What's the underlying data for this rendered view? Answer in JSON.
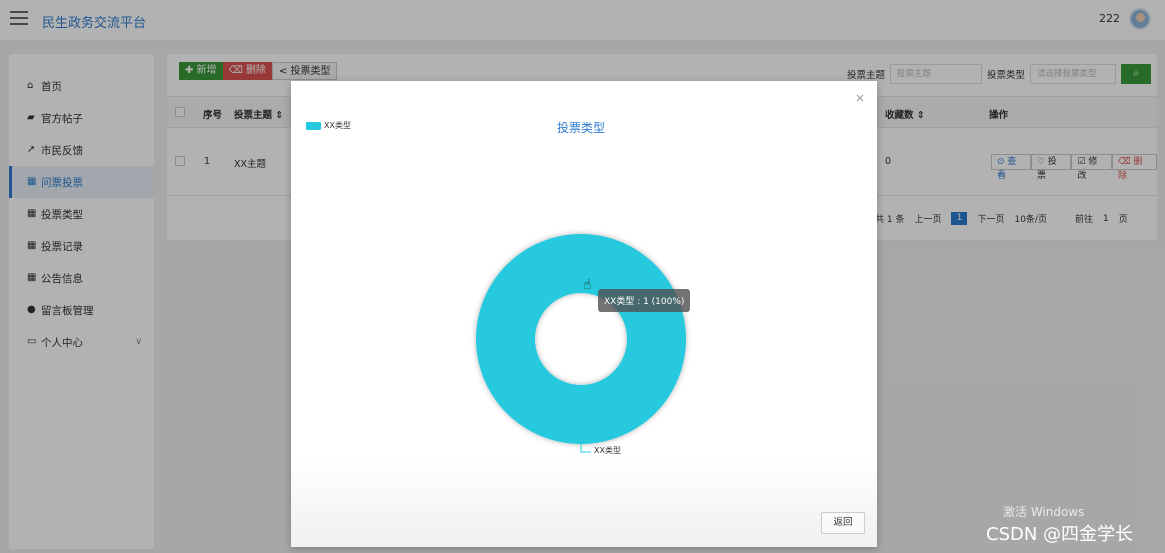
{
  "header": {
    "title": "民生政务交流平台",
    "username": "222"
  },
  "sidebar": {
    "items": [
      {
        "label": "首页",
        "icon": "home-icon",
        "glyph": "⌂"
      },
      {
        "label": "官方帖子",
        "icon": "post-icon",
        "glyph": "▰"
      },
      {
        "label": "市民反馈",
        "icon": "send-icon",
        "glyph": "➚"
      },
      {
        "label": "问票投票",
        "icon": "grid-icon",
        "glyph": "▦"
      },
      {
        "label": "投票类型",
        "icon": "grid-icon",
        "glyph": "▦"
      },
      {
        "label": "投票记录",
        "icon": "grid-icon",
        "glyph": "▦"
      },
      {
        "label": "公告信息",
        "icon": "grid-icon",
        "glyph": "▦"
      },
      {
        "label": "留言板管理",
        "icon": "user-icon",
        "glyph": "●"
      },
      {
        "label": "个人中心",
        "icon": "card-icon",
        "glyph": "▭",
        "chevron": "∨"
      }
    ]
  },
  "toolbar": {
    "add_label": "✚ 新增",
    "delete_label": "⌫ 删除",
    "type_label": "< 投票类型"
  },
  "search": {
    "subject_label": "投票主题",
    "subject_placeholder": "投票主题",
    "type_label": "投票类型",
    "type_placeholder": "请选择投票类型",
    "search_icon": "search-icon",
    "search_glyph": "⌕"
  },
  "table": {
    "headers": {
      "index": "序号",
      "subject": "投票主题 ⇕",
      "count": "收藏数 ⇕",
      "ops": "操作"
    },
    "rows": [
      {
        "index": "1",
        "subject": "XX主题",
        "count": "0"
      }
    ],
    "row_actions": {
      "view": "⊙ 查看",
      "vote": "♡ 投票",
      "edit": "☑ 修改",
      "delete": "⌫ 删除"
    }
  },
  "pagination": {
    "total": "共 1 条",
    "prev": "上一页",
    "current": "1",
    "next": "下一页",
    "page_size": "10条/页",
    "goto_prefix": "前往",
    "goto_value": "1",
    "goto_suffix": "页"
  },
  "modal": {
    "close_glyph": "×",
    "chart_title": "投票类型",
    "tooltip": "XX类型 : 1 (100%)",
    "back_label": "返回"
  },
  "chart_data": {
    "type": "pie",
    "title": "投票类型",
    "categories": [
      "XX类型"
    ],
    "values": [
      1
    ],
    "percent": [
      100
    ],
    "legend": [
      "XX类型"
    ],
    "legend_position": "top-left",
    "donut": true,
    "color": "#25c9de"
  },
  "watermark": "激活 Windows",
  "csdn_credit": "CSDN @四金学长"
}
